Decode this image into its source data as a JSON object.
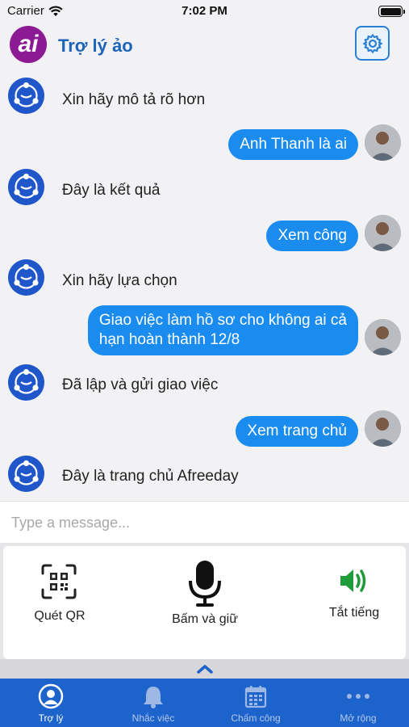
{
  "status_bar": {
    "carrier": "Carrier",
    "time": "7:02 PM"
  },
  "header": {
    "logo_text": "ai",
    "title": "Trợ lý ảo"
  },
  "messages": [
    {
      "sender": "bot",
      "text": "Xin hãy mô tả rõ hơn"
    },
    {
      "sender": "user",
      "text": "Anh Thanh là ai"
    },
    {
      "sender": "bot",
      "text": "Đây là kết quả"
    },
    {
      "sender": "user",
      "text": "Xem công"
    },
    {
      "sender": "bot",
      "text": "Xin hãy lựa chọn"
    },
    {
      "sender": "user",
      "line1": "Giao việc làm hồ sơ cho không ai cả",
      "line2": "hạn hoàn thành 12/8"
    },
    {
      "sender": "bot",
      "text": "Đã lập và gửi giao việc"
    },
    {
      "sender": "user",
      "text": "Xem trang chủ"
    },
    {
      "sender": "bot",
      "text": "Đây là trang chủ Afreeday"
    }
  ],
  "input": {
    "placeholder": "Type a message..."
  },
  "actions": {
    "qr_label": "Quét QR",
    "mic_label": "Bấm và giữ",
    "sound_label": "Tắt tiếng",
    "sound_icon_color": "#1f9c3a"
  },
  "tabs": [
    {
      "label": "Trợ lý",
      "icon": "person-icon",
      "active": true
    },
    {
      "label": "Nhắc việc",
      "icon": "bell-icon",
      "active": false
    },
    {
      "label": "Chấm công",
      "icon": "calendar-icon",
      "active": false
    },
    {
      "label": "Mở rộng",
      "icon": "more-dots-icon",
      "active": false
    }
  ],
  "colors": {
    "accent": "#1a8cf0",
    "tab_bar": "#1c63cc",
    "title": "#1d63b8",
    "logo": "#8b1a94"
  }
}
